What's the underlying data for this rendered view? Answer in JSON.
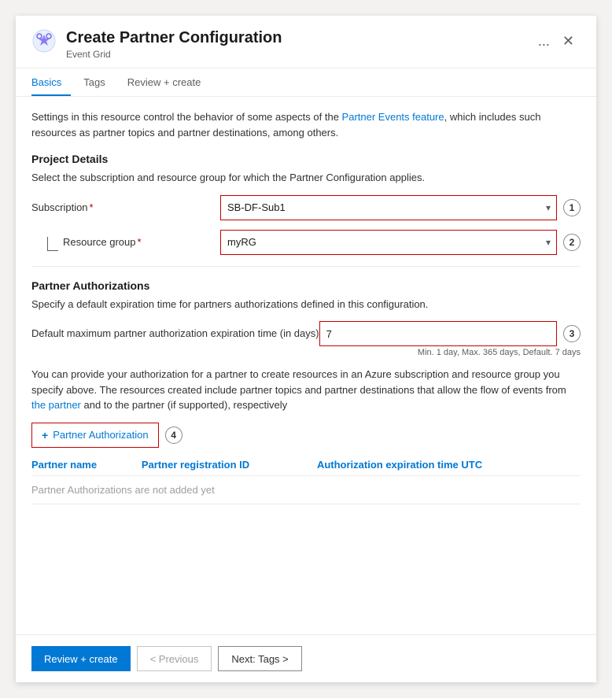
{
  "header": {
    "title": "Create Partner Configuration",
    "subtitle": "Event Grid",
    "menu_label": "...",
    "close_label": "✕"
  },
  "tabs": [
    {
      "id": "basics",
      "label": "Basics",
      "active": true
    },
    {
      "id": "tags",
      "label": "Tags",
      "active": false
    },
    {
      "id": "review",
      "label": "Review + create",
      "active": false
    }
  ],
  "basics": {
    "intro": "Settings in this resource control the behavior of some aspects of the Partner Events feature, which includes such resources as partner topics and partner destinations, among others.",
    "project_details": {
      "title": "Project Details",
      "desc": "Select the subscription and resource group for which the Partner Configuration applies.",
      "subscription_label": "Subscription",
      "subscription_value": "SB-DF-Sub1",
      "subscription_badge": "1",
      "resource_group_label": "Resource group",
      "resource_group_value": "myRG",
      "resource_group_badge": "2"
    },
    "partner_authorizations": {
      "title": "Partner Authorizations",
      "desc": "Specify a default expiration time for partners authorizations defined in this configuration.",
      "days_label": "Default maximum partner authorization expiration time (in days)",
      "days_value": "7",
      "days_hint": "Min. 1 day, Max. 365 days, Default. 7 days",
      "days_badge": "3",
      "info_text": "You can provide your authorization for a partner to create resources in an Azure subscription and resource group you specify above. The resources created include partner topics and partner destinations that allow the flow of events from the partner and to the partner (if supported), respectively",
      "add_button_label": "Partner Authorization",
      "add_button_badge": "4",
      "table": {
        "columns": [
          "Partner name",
          "Partner registration ID",
          "Authorization expiration time UTC"
        ],
        "empty_message": "Partner Authorizations are not added yet"
      }
    }
  },
  "footer": {
    "review_create_label": "Review + create",
    "previous_label": "< Previous",
    "next_label": "Next: Tags >"
  },
  "icons": {
    "gear": "⚙",
    "chevron_down": "▾",
    "plus": "+",
    "close": "✕",
    "ellipsis": "···"
  },
  "colors": {
    "blue": "#0078d4",
    "red_border": "#c50000",
    "text_dark": "#1b1b1b",
    "text_medium": "#323130",
    "text_light": "#605e5c",
    "border": "#edebe9"
  }
}
